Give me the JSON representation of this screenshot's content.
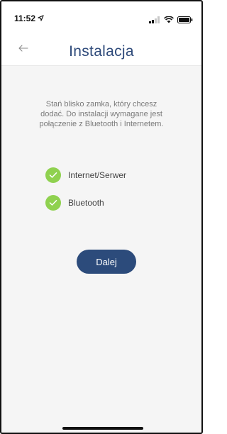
{
  "status_bar": {
    "time": "11:52",
    "location_icon": "location-arrow-icon",
    "signal_icon": "cellular-signal-icon",
    "wifi_icon": "wifi-icon",
    "battery_icon": "battery-icon"
  },
  "header": {
    "back_icon": "back-arrow-icon",
    "title": "Instalacja"
  },
  "main": {
    "intro": "Stań blisko zamka, który chcesz dodać. Do instalacji wymagane jest połączenie z Bluetooth i Internetem.",
    "requirements": [
      {
        "label": "Internet/Serwer",
        "status": "checked",
        "icon": "check-icon"
      },
      {
        "label": "Bluetooth",
        "status": "checked",
        "icon": "check-icon"
      }
    ],
    "next_button": "Dalej"
  },
  "colors": {
    "accent": "#2c4b7b",
    "title": "#2e4a7a",
    "check": "#8fd14f",
    "background": "#f5f5f5"
  }
}
